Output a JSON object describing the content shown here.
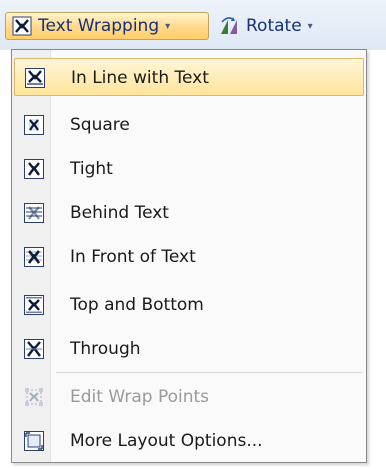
{
  "toolbar": {
    "text_wrapping_label": "Text Wrapping",
    "rotate_label": "Rotate"
  },
  "menu": {
    "items": [
      {
        "label": "In Line with Text",
        "icon": "inline-wrap-icon",
        "state": "highlighted"
      },
      {
        "label": "Square",
        "icon": "square-wrap-icon"
      },
      {
        "label": "Tight",
        "icon": "tight-wrap-icon"
      },
      {
        "label": "Behind Text",
        "icon": "behind-text-icon"
      },
      {
        "label": "In Front of Text",
        "icon": "in-front-of-text-icon"
      },
      {
        "label": "Top and Bottom",
        "icon": "top-bottom-wrap-icon"
      },
      {
        "label": "Through",
        "icon": "through-wrap-icon"
      },
      {
        "label": "Edit Wrap Points",
        "icon": "edit-wrap-points-icon",
        "state": "disabled"
      },
      {
        "label": "More Layout Options...",
        "icon": "layout-options-icon"
      }
    ]
  },
  "colors": {
    "highlight_top": "#fff6d8",
    "highlight_bottom": "#ffe49a",
    "toolbar_text": "#15317a",
    "disabled_text": "#9a9a9a"
  }
}
